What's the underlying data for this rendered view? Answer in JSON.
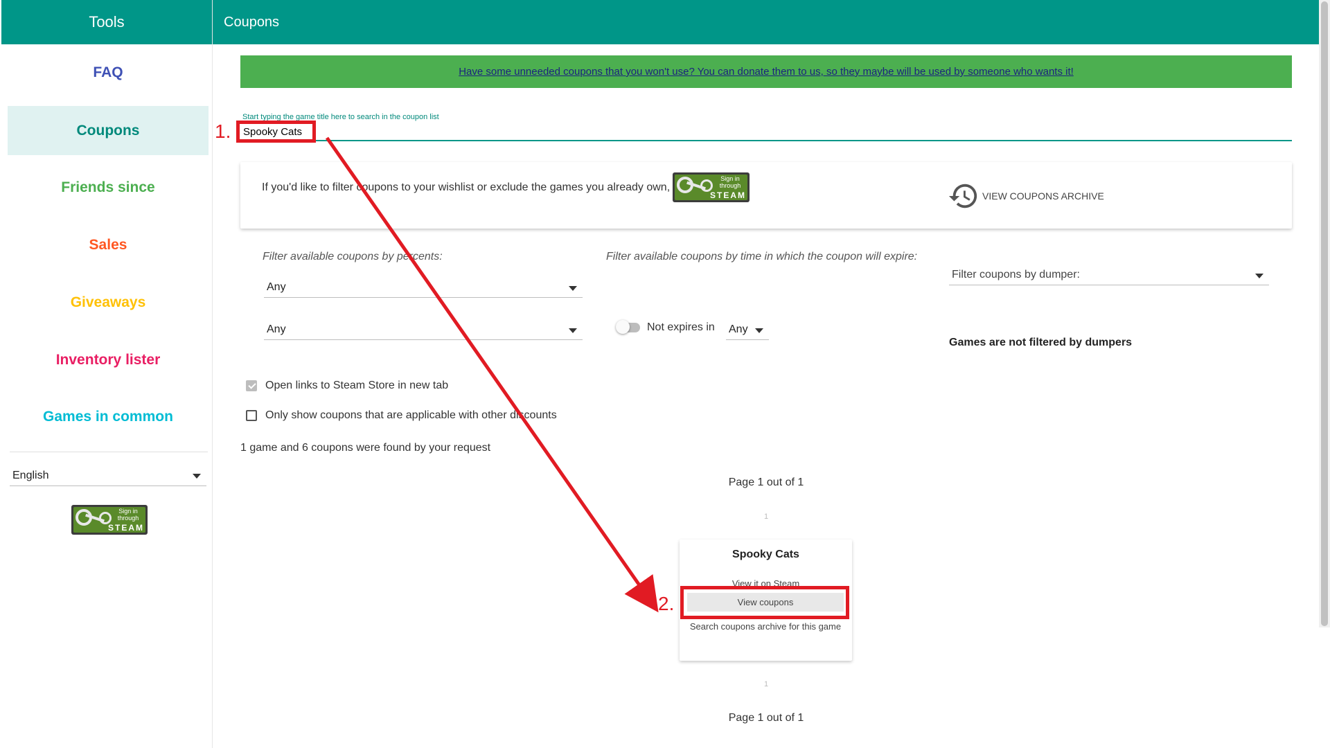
{
  "sidebar": {
    "title": "Tools",
    "items": [
      {
        "label": "FAQ",
        "color": "#3f51b5"
      },
      {
        "label": "Coupons",
        "color": "#00897b"
      },
      {
        "label": "Friends since",
        "color": "#4caf50"
      },
      {
        "label": "Sales",
        "color": "#ff5722"
      },
      {
        "label": "Giveaways",
        "color": "#ffc107"
      },
      {
        "label": "Inventory lister",
        "color": "#e91e63"
      },
      {
        "label": "Games in common",
        "color": "#00bcd4"
      }
    ],
    "language": "English",
    "steam_sign_in": {
      "line1": "Sign in",
      "line2": "through",
      "brand": "STEAM"
    }
  },
  "header": {
    "title": "Coupons"
  },
  "donate_banner": "Have some unneeded coupons that you won't use? You can donate them to us, so they maybe will be used by someone who wants it!",
  "search": {
    "label": "Start typing the game title here to search in the coupon list",
    "value": "Spooky Cats"
  },
  "filter_card": {
    "wishlist_text": "If you'd like to filter coupons to your wishlist or exclude the games you already own,",
    "steam_sign_in": {
      "line1": "Sign in",
      "line2": "through",
      "brand": "STEAM"
    },
    "archive_label": "VIEW COUPONS ARCHIVE",
    "archive_icon": "history-icon"
  },
  "filters": {
    "percent_label": "Filter available coupons by percents:",
    "percent_select_1": "Any",
    "percent_select_2": "Any",
    "time_label": "Filter available coupons by time in which the coupon will expire:",
    "not_expires_label": "Not expires in",
    "not_expires_value": "Any",
    "dumper_placeholder": "Filter coupons by dumper:",
    "dumper_status": "Games are not filtered by dumpers"
  },
  "options": {
    "open_links_label": "Open links to Steam Store in new tab",
    "open_links_checked": true,
    "only_applicable_label": "Only show coupons that are applicable with other discounts",
    "only_applicable_checked": false
  },
  "results": {
    "summary": "1 game and 6 coupons were found by your request",
    "page_text_top": "Page 1 out of 1",
    "page_number_top": "1",
    "page_number_bottom": "1",
    "page_text_bottom": "Page 1 out of 1"
  },
  "game_card": {
    "title": "Spooky Cats",
    "view_steam": "View it on Steam",
    "view_coupons": "View coupons",
    "search_archive": "Search coupons archive for this game"
  },
  "annotations": {
    "step1": "1.",
    "step2": "2.",
    "color": "#e11b23"
  }
}
